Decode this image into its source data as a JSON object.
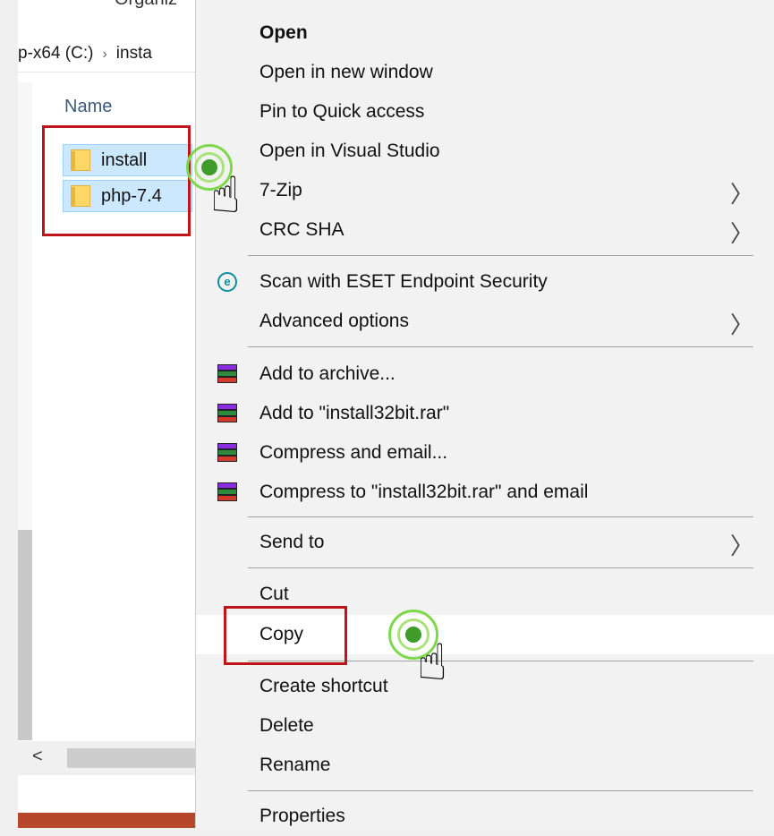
{
  "explorer": {
    "ribbon_tab": "Organiz",
    "address": {
      "drive": "p-x64 (C:)",
      "folder": "insta"
    },
    "column_header": "Name",
    "files": [
      "install",
      "php-7.4"
    ],
    "scroll_left_glyph": "<"
  },
  "context_menu": {
    "open": "Open",
    "open_new_window": "Open in new window",
    "pin_quick_access": "Pin to Quick access",
    "open_visual_studio": "Open in Visual Studio",
    "seven_zip": "7-Zip",
    "crc_sha": "CRC SHA",
    "scan_eset": "Scan with ESET Endpoint Security",
    "eset_icon_letter": "e",
    "advanced_options": "Advanced options",
    "add_to_archive": "Add to archive...",
    "add_to_rar": "Add to \"install32bit.rar\"",
    "compress_email": "Compress and email...",
    "compress_rar_email": "Compress to \"install32bit.rar\" and email",
    "send_to": "Send to",
    "cut": "Cut",
    "copy": "Copy",
    "create_shortcut": "Create shortcut",
    "delete": "Delete",
    "rename": "Rename",
    "properties": "Properties",
    "submenu_glyph": "〉"
  },
  "colors": {
    "highlight_box": "#c0141c",
    "selection": "#cce8ff",
    "touch_ring": "#7dd84a",
    "taskbar_accent": "#b7472a"
  },
  "icons": [
    "folder-icon",
    "eset-icon",
    "winrar-icon",
    "chevron-right-icon",
    "chevron-left-icon",
    "pointing-hand-icon"
  ]
}
